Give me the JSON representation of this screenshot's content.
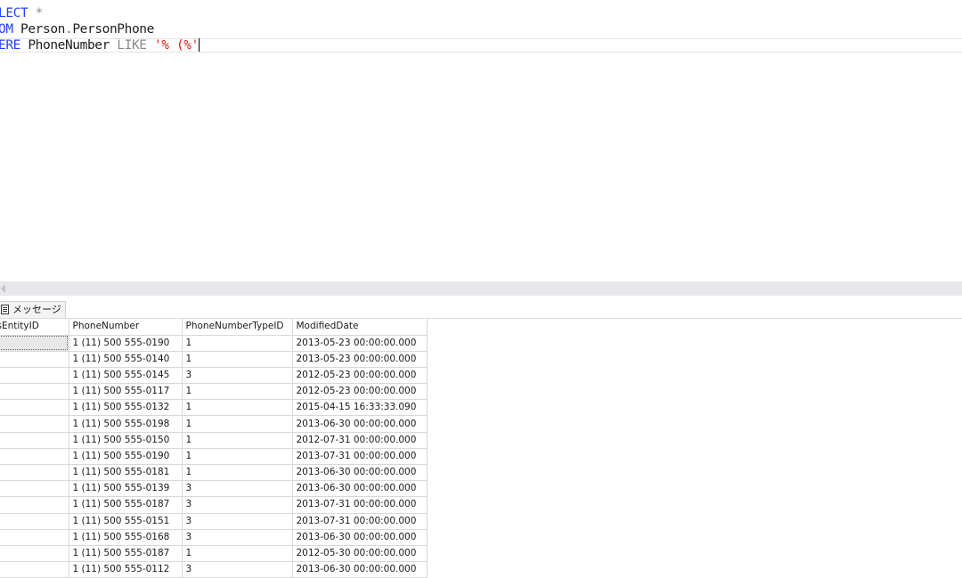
{
  "editor": {
    "lines": [
      {
        "parts": [
          {
            "cls": "kw",
            "text": "LECT"
          },
          {
            "cls": "star",
            "text": " *"
          }
        ]
      },
      {
        "parts": [
          {
            "cls": "kw",
            "text": "OM"
          },
          {
            "cls": "ident",
            "text": " Person"
          },
          {
            "cls": "dot",
            "text": "."
          },
          {
            "cls": "ident",
            "text": "PersonPhone"
          }
        ]
      },
      {
        "parts": [
          {
            "cls": "kw",
            "text": "ERE"
          },
          {
            "cls": "ident",
            "text": " PhoneNumber "
          },
          {
            "cls": "op",
            "text": "LIKE"
          },
          {
            "cls": "str",
            "text": " '% (%'"
          }
        ]
      }
    ]
  },
  "results": {
    "messages_tab": "メッセージ",
    "columns": [
      "inessEntityID",
      "PhoneNumber",
      "PhoneNumberTypeID",
      "ModifiedDate"
    ],
    "rows": [
      [
        "",
        "1 (11) 500 555-0190",
        "1",
        "2013-05-23 00:00:00.000"
      ],
      [
        "",
        "1 (11) 500 555-0140",
        "1",
        "2013-05-23 00:00:00.000"
      ],
      [
        "",
        "1 (11) 500 555-0145",
        "3",
        "2012-05-23 00:00:00.000"
      ],
      [
        "",
        "1 (11) 500 555-0117",
        "1",
        "2012-05-23 00:00:00.000"
      ],
      [
        "",
        "1 (11) 500 555-0132",
        "1",
        "2015-04-15 16:33:33.090"
      ],
      [
        "",
        "1 (11) 500 555-0198",
        "1",
        "2013-06-30 00:00:00.000"
      ],
      [
        "",
        "1 (11) 500 555-0150",
        "1",
        "2012-07-31 00:00:00.000"
      ],
      [
        "",
        "1 (11) 500 555-0190",
        "1",
        "2013-07-31 00:00:00.000"
      ],
      [
        "",
        "1 (11) 500 555-0181",
        "1",
        "2013-06-30 00:00:00.000"
      ],
      [
        "",
        "1 (11) 500 555-0139",
        "3",
        "2013-06-30 00:00:00.000"
      ],
      [
        "",
        "1 (11) 500 555-0187",
        "3",
        "2013-07-31 00:00:00.000"
      ],
      [
        "",
        "1 (11) 500 555-0151",
        "3",
        "2013-07-31 00:00:00.000"
      ],
      [
        "",
        "1 (11) 500 555-0168",
        "3",
        "2013-06-30 00:00:00.000"
      ],
      [
        "",
        "1 (11) 500 555-0187",
        "1",
        "2012-05-30 00:00:00.000"
      ],
      [
        "",
        "1 (11) 500 555-0112",
        "3",
        "2013-06-30 00:00:00.000"
      ]
    ]
  }
}
